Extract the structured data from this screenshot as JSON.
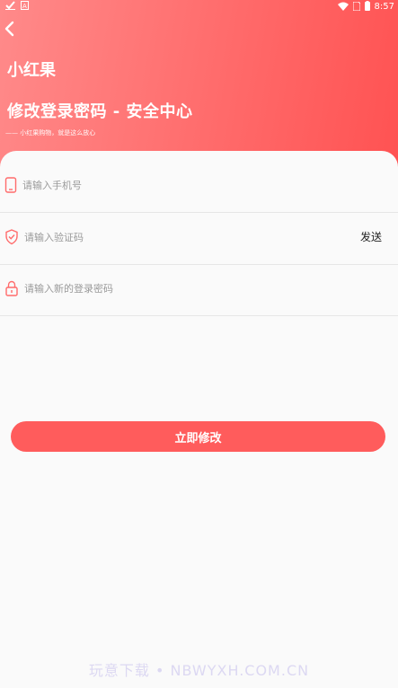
{
  "status_bar": {
    "time": "8:57"
  },
  "header": {
    "back_icon": "chevron-left-icon",
    "app_name": "小红果",
    "title": "修改登录密码 - 安全中心",
    "slogan": "—— 小红果购物，就是这么放心"
  },
  "form": {
    "phone": {
      "icon": "phone-icon",
      "placeholder": "请输入手机号",
      "value": ""
    },
    "code": {
      "icon": "shield-check-icon",
      "placeholder": "请输入验证码",
      "value": "",
      "send_label": "发送"
    },
    "password": {
      "icon": "lock-icon",
      "placeholder": "请输入新的登录密码",
      "value": ""
    }
  },
  "submit": {
    "label": "立即修改"
  },
  "watermark": "玩意下载 • NBWYXH.COM.CN",
  "colors": {
    "accent": "#ff5c5c",
    "header_start": "#ff8a8a",
    "header_end": "#ff5252",
    "background": "#fafafa"
  }
}
